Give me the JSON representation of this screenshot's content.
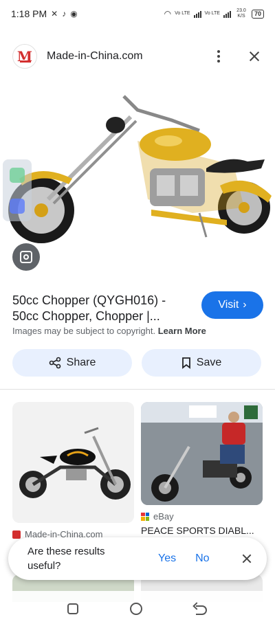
{
  "status_bar": {
    "time": "1:18 PM",
    "network_label_1": "Vo LTE",
    "network_label_2": "Vo LTE",
    "speed": "23.0 K/S",
    "battery": "70"
  },
  "header": {
    "site_name": "Made-in-China.com",
    "logo_letter": "M"
  },
  "result": {
    "title": "50cc Chopper (QYGH016) - 50cc Chopper, Chopper |...",
    "visit_label": "Visit",
    "copyright_text": "Images may be subject to copyright.",
    "learn_more": "Learn More",
    "share_label": "Share",
    "save_label": "Save"
  },
  "related": [
    {
      "source": "Made-in-China.com",
      "title": ""
    },
    {
      "source": "eBay",
      "title": "PEACE SPORTS DIABL..."
    }
  ],
  "feedback": {
    "question": "Are these results useful?",
    "yes": "Yes",
    "no": "No"
  },
  "colors": {
    "accent": "#1a73e8",
    "pill_bg": "#e8f0fe",
    "brand_red": "#d32f2f"
  }
}
